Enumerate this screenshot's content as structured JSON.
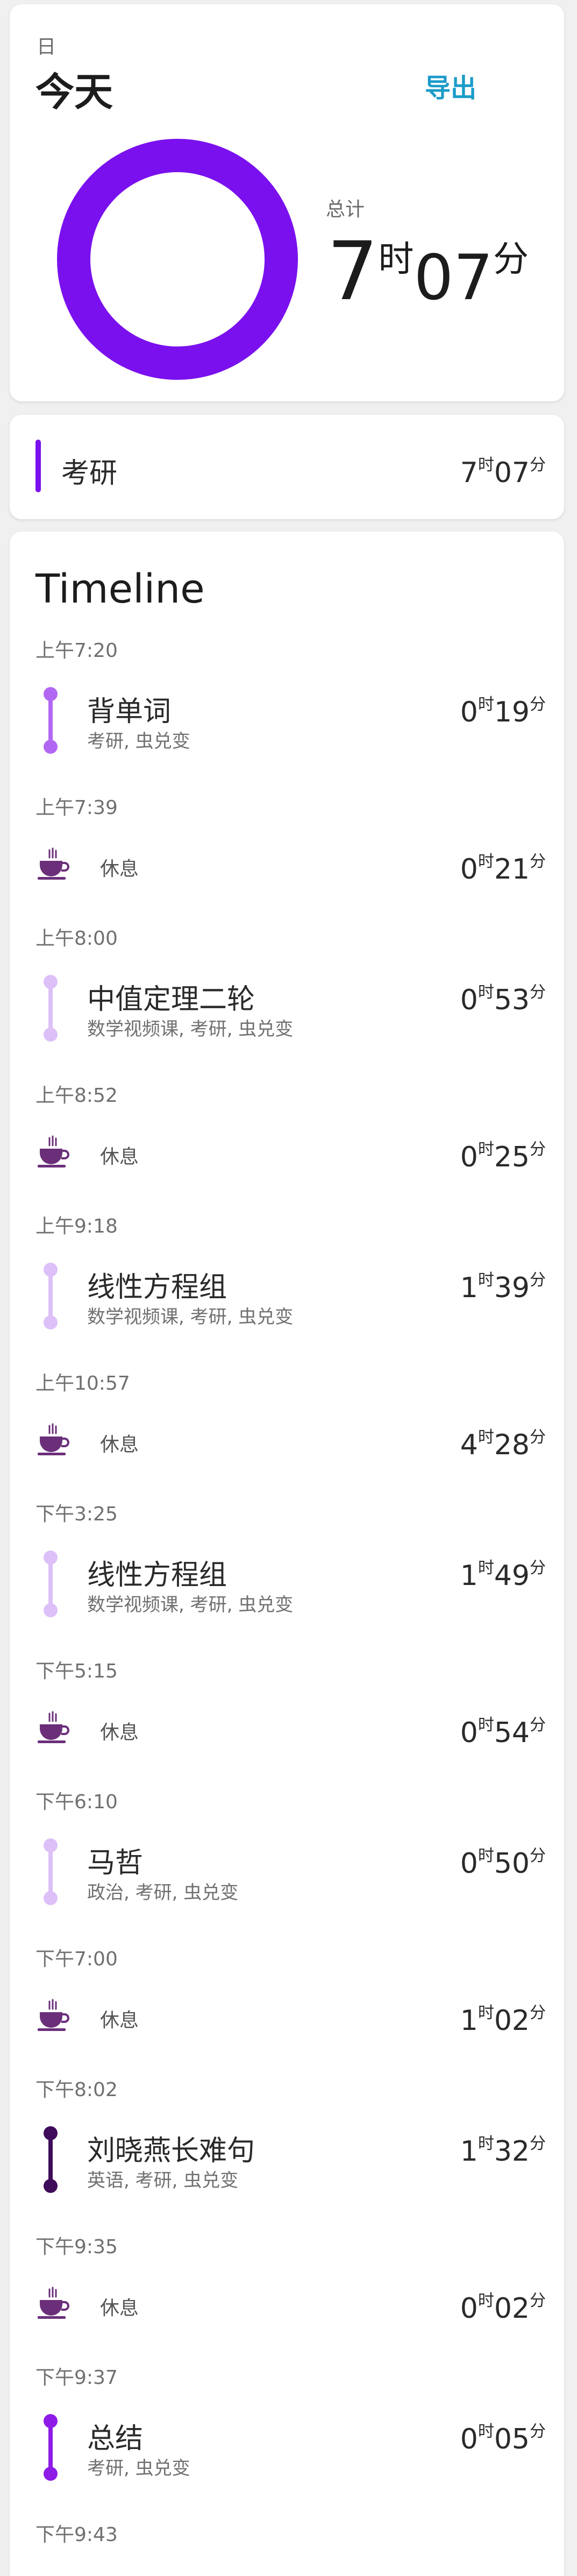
{
  "summary": {
    "period": "日",
    "day_title": "今天",
    "export_label": "导出",
    "total_label": "总计",
    "total_hours": "7",
    "total_minutes": "07",
    "hour_unit": "时",
    "minute_unit": "分",
    "donut_color": "#7a10ee"
  },
  "category": {
    "name": "考研",
    "hours": "7",
    "minutes": "07",
    "color": "#7a10ee"
  },
  "timeline": {
    "title": "Timeline",
    "entries": [
      {
        "time": "上午7:20",
        "kind": "activity",
        "name": "背单词",
        "tags": "考研, 虫兑变",
        "hours": "0",
        "minutes": "19",
        "color": "#b267f3"
      },
      {
        "time": "上午7:39",
        "kind": "break",
        "name": "休息",
        "hours": "0",
        "minutes": "21"
      },
      {
        "time": "上午8:00",
        "kind": "activity",
        "name": "中值定理二轮",
        "tags": "数学视频课, 考研, 虫兑变",
        "hours": "0",
        "minutes": "53",
        "color": "#dcc0f7"
      },
      {
        "time": "上午8:52",
        "kind": "break",
        "name": "休息",
        "hours": "0",
        "minutes": "25"
      },
      {
        "time": "上午9:18",
        "kind": "activity",
        "name": "线性方程组",
        "tags": "数学视频课, 考研, 虫兑变",
        "hours": "1",
        "minutes": "39",
        "color": "#dcc0f7"
      },
      {
        "time": "上午10:57",
        "kind": "break",
        "name": "休息",
        "hours": "4",
        "minutes": "28"
      },
      {
        "time": "下午3:25",
        "kind": "activity",
        "name": "线性方程组",
        "tags": "数学视频课, 考研, 虫兑变",
        "hours": "1",
        "minutes": "49",
        "color": "#dcc0f7"
      },
      {
        "time": "下午5:15",
        "kind": "break",
        "name": "休息",
        "hours": "0",
        "minutes": "54"
      },
      {
        "time": "下午6:10",
        "kind": "activity",
        "name": "马哲",
        "tags": "政治, 考研, 虫兑变",
        "hours": "0",
        "minutes": "50",
        "color": "#dcc0f7"
      },
      {
        "time": "下午7:00",
        "kind": "break",
        "name": "休息",
        "hours": "1",
        "minutes": "02"
      },
      {
        "time": "下午8:02",
        "kind": "activity",
        "name": "刘晓燕长难句",
        "tags": "英语, 考研, 虫兑变",
        "hours": "1",
        "minutes": "32",
        "color": "#3e0c5a"
      },
      {
        "time": "下午9:35",
        "kind": "break",
        "name": "休息",
        "hours": "0",
        "minutes": "02"
      },
      {
        "time": "下午9:37",
        "kind": "activity",
        "name": "总结",
        "tags": "考研, 虫兑变",
        "hours": "0",
        "minutes": "05",
        "color": "#8e1be6"
      },
      {
        "time": "下午9:43",
        "kind": "end"
      }
    ]
  },
  "icons": {
    "break": "coffee-cup-icon",
    "break_color": "#6b2f7a"
  }
}
